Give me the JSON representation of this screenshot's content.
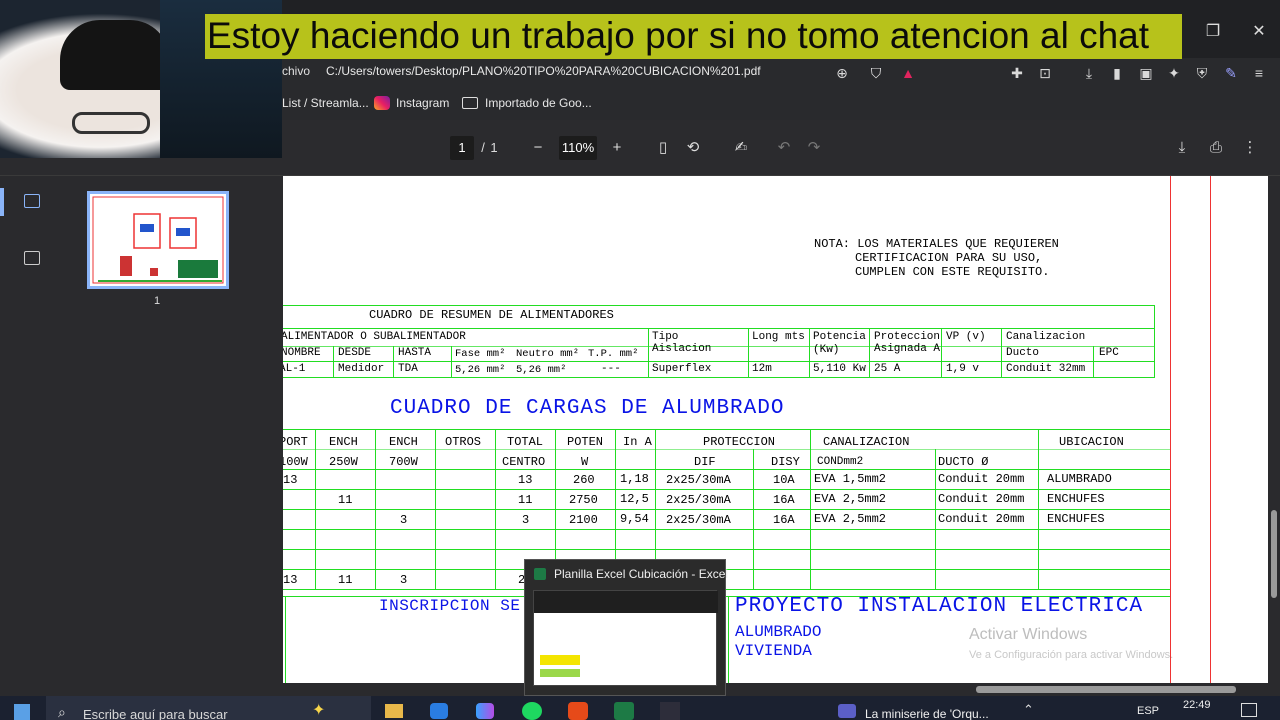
{
  "browser": {
    "address_prefix": "chivo",
    "url": "C:/Users/towers/Desktop/PLANO%20TIPO%20PARA%20CUBICACION%201.pdf",
    "bookmarks": [
      {
        "label": "List / Streamla..."
      },
      {
        "label": "Instagram"
      },
      {
        "label": "Importado de Goo..."
      }
    ]
  },
  "pdf_toolbar": {
    "page_current": "1",
    "page_separator": "/",
    "page_total": "1",
    "zoom": "110%"
  },
  "sidebar": {
    "thumbnail_page_label": "1"
  },
  "document": {
    "note_line1": "NOTA: LOS MATERIALES QUE REQUIEREN",
    "note_line2": "CERTIFICACION PARA SU USO,",
    "note_line3": "CUMPLEN CON ESTE REQUISITO.",
    "summary": {
      "title": "CUADRO DE RESUMEN DE ALIMENTADORES",
      "h_alim": "ALIMENTADOR O SUBALIMENTADOR",
      "h_tipo1": "Tipo",
      "h_tipo2": "Aislacion",
      "h_long": "Long mts",
      "h_pot1": "Potencia",
      "h_pot2": "(Kw)",
      "h_prot1": "Proteccion",
      "h_prot2": "Asignada A",
      "h_vp": "VP (v)",
      "h_canal": "Canalizacion",
      "h_nombre": "NOMBRE",
      "h_desde": "DESDE",
      "h_hasta": "HASTA",
      "h_fase": "Fase mm²",
      "h_neutro": "Neutro mm²",
      "h_tp": "T.P. mm²",
      "h_ducto": "Ducto",
      "h_epc": "EPC",
      "row": {
        "nombre": "AL-1",
        "desde": "Medidor",
        "hasta": "TDA",
        "fase": "5,26 mm²",
        "neutro": "5,26 mm²",
        "tp": "---",
        "tipo": "Superflex",
        "long": "12m",
        "pot": "5,110 Kw",
        "prot": "25 A",
        "vp": "1,9 v",
        "canal": "Conduit 32mm"
      }
    },
    "loads": {
      "title": "CUADRO DE CARGAS DE ALUMBRADO",
      "headers": {
        "c_port": "PORT",
        "c_ench1": "ENCH",
        "c_ench2": "ENCH",
        "c_otros": "OTROS",
        "c_total": "TOTAL",
        "c_poten": "POTEN",
        "c_ina": "In A",
        "c_prot": "PROTECCION",
        "c_canal": "CANALIZACION",
        "c_ubic": "UBICACION",
        "s_port": "100W",
        "s_ench1": "250W",
        "s_ench2": "700W",
        "s_total": "CENTRO",
        "s_poten": "W",
        "s_dif": "DIF",
        "s_disy": "DISY",
        "s_cond": "CONDmm2",
        "s_ducto": "DUCTO Ø"
      },
      "rows": [
        {
          "port": "13",
          "ench1": "",
          "ench2": "",
          "total": "13",
          "poten": "260",
          "ina": "1,18",
          "dif": "2x25/30mA",
          "disy": "10A",
          "cond": "EVA 1,5mm2",
          "ducto": "Conduit 20mm",
          "ubic": "ALUMBRADO"
        },
        {
          "port": "",
          "ench1": "11",
          "ench2": "",
          "total": "11",
          "poten": "2750",
          "ina": "12,5",
          "dif": "2x25/30mA",
          "disy": "16A",
          "cond": "EVA 2,5mm2",
          "ducto": "Conduit 20mm",
          "ubic": "ENCHUFES"
        },
        {
          "port": "",
          "ench1": "",
          "ench2": "3",
          "total": "3",
          "poten": "2100",
          "ina": "9,54",
          "dif": "2x25/30mA",
          "disy": "16A",
          "cond": "EVA 2,5mm2",
          "ducto": "Conduit 20mm",
          "ubic": "ENCHUFES"
        }
      ],
      "totals": {
        "port": "13",
        "ench1": "11",
        "ench2": "3",
        "total": "27"
      }
    },
    "inscripcion": "INSCRIPCION SE",
    "project_title": "PROYECTO INSTALACION ELECTRICA",
    "project_sub1": "ALUMBRADO",
    "project_sub2": "VIVIENDA"
  },
  "overlays": {
    "subtitle": "Estoy haciendo un trabajo por si no tomo atencion al chat",
    "excel_popup_title": "Planilla Excel Cubicación - Excel",
    "watermark_line1": "Activar Windows",
    "watermark_line2": "Ve a Configuración para activar Windows."
  },
  "taskbar": {
    "search_placeholder": "Escribe aquí para buscar",
    "media_title": "La miniserie de 'Orqu...",
    "language": "ESP",
    "time": "22:49"
  },
  "colors": {
    "accent_blue": "#8ab4f8",
    "cad_green": "#22dd22",
    "cad_blue": "#0a14e6",
    "subtitle_bg": "#b7c21b"
  }
}
